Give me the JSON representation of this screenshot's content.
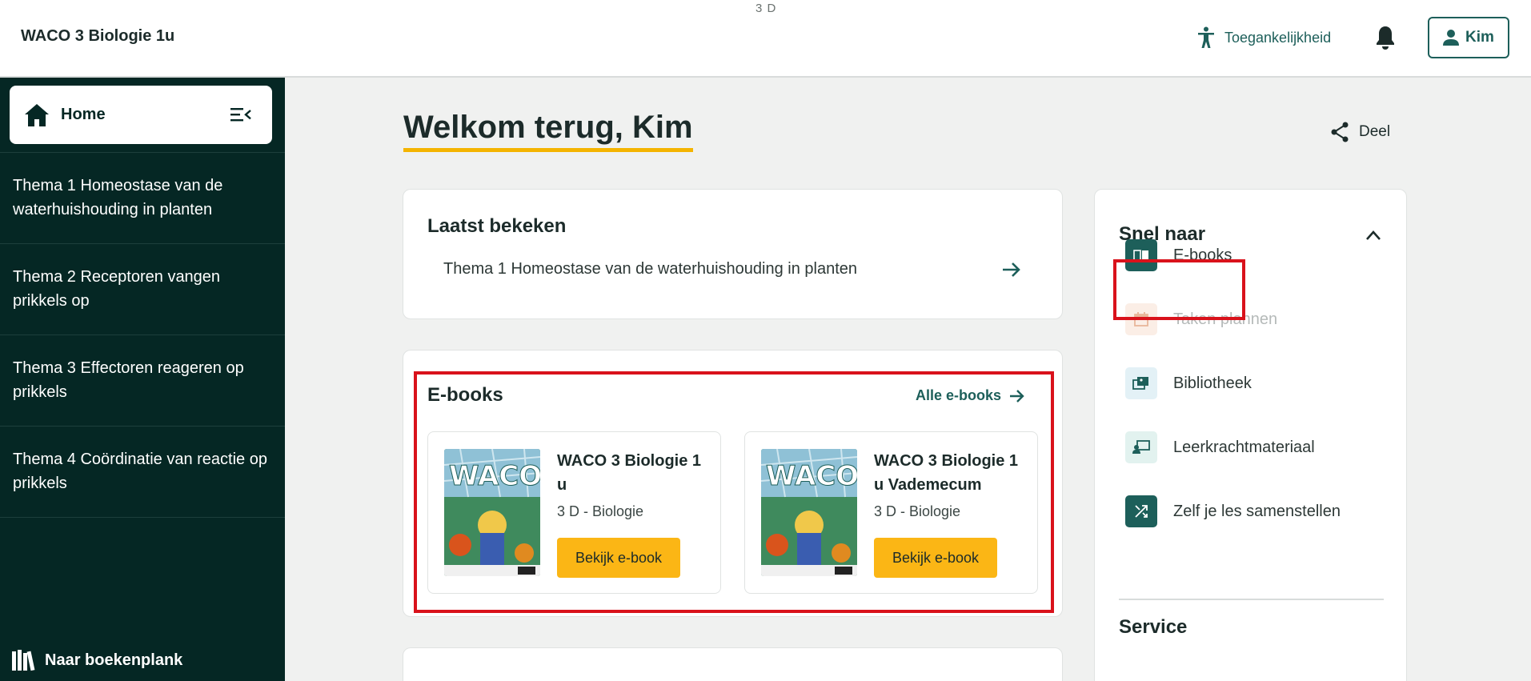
{
  "header": {
    "app_title": "WACO 3 Biologie 1u",
    "class_label": "3 D",
    "accessibility_label": "Toegankelijkheid",
    "user_name": "Kim"
  },
  "sidebar": {
    "home_label": "Home",
    "items": [
      {
        "label": "Thema 1 Homeostase van de waterhuishouding in planten"
      },
      {
        "label": "Thema 2 Receptoren vangen prikkels op"
      },
      {
        "label": "Thema 3 Effectoren reageren op prikkels"
      },
      {
        "label": "Thema 4 Coördinatie van reactie op prikkels"
      }
    ],
    "bookshelf_label": "Naar boekenplank"
  },
  "main": {
    "welcome": "Welkom terug, Kim",
    "share_label": "Deel",
    "recent": {
      "title": "Laatst bekeken",
      "item": "Thema 1 Homeostase van de waterhuishouding in planten"
    },
    "ebooks": {
      "title": "E-books",
      "all_link": "Alle e-books",
      "books": [
        {
          "title": "WACO 3 Biologie 1 u",
          "subtitle": "3 D - Biologie",
          "button": "Bekijk e-book"
        },
        {
          "title": "WACO 3 Biologie 1 u Vademecum",
          "subtitle": "3 D - Biologie",
          "button": "Bekijk e-book"
        }
      ]
    }
  },
  "quick": {
    "title": "Snel naar",
    "items": [
      {
        "label": "E-books",
        "icon": "ebook-icon"
      },
      {
        "label": "Taken plannen",
        "icon": "calendar-icon"
      },
      {
        "label": "Bibliotheek",
        "icon": "library-icon"
      },
      {
        "label": "Leerkrachtmateriaal",
        "icon": "teacher-icon"
      },
      {
        "label": "Zelf je les samenstellen",
        "icon": "shuffle-icon"
      }
    ],
    "service_title": "Service"
  },
  "colors": {
    "brand_dark": "#052724",
    "accent_teal": "#1d5f5a",
    "button_yellow": "#fbb615",
    "highlight_red": "#d9121b"
  }
}
